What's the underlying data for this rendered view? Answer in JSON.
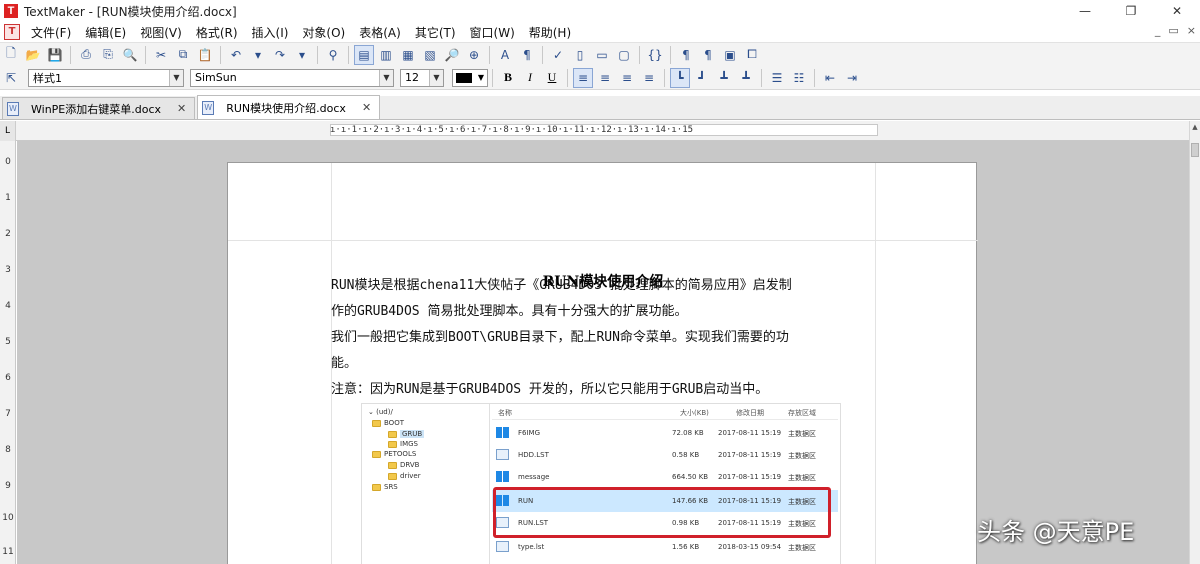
{
  "window": {
    "title": "TextMaker - [RUN模块使用介绍.docx]",
    "minimize_icon": "minimize-icon",
    "maximize_icon": "maximize-icon",
    "close_icon": "close-icon"
  },
  "menu": {
    "items": [
      "文件(F)",
      "编辑(E)",
      "视图(V)",
      "格式(R)",
      "插入(I)",
      "对象(O)",
      "表格(A)",
      "其它(T)",
      "窗口(W)",
      "帮助(H)"
    ],
    "right_controls": [
      "_",
      "▭",
      "×"
    ]
  },
  "format_toolbar": {
    "style": "样式1",
    "font": "SimSun",
    "size": "12",
    "font_color": "#000000",
    "bold": "B",
    "italic": "I",
    "underline": "U"
  },
  "tabs": [
    {
      "label": "WinPE添加右键菜单.docx",
      "active": false
    },
    {
      "label": "RUN模块使用介绍.docx",
      "active": true
    }
  ],
  "ruler": {
    "horizontal": "ı·ı·1·ı·2·ı·3·ı·4·ı·5·ı·6·ı·7·ı·8·ı·9·ı·10·ı·11·ı·12·ı·13·ı·14·ı·15",
    "vertical": [
      "0",
      "1",
      "2",
      "3",
      "4",
      "5",
      "6",
      "7",
      "8",
      "9",
      "10",
      "11"
    ]
  },
  "document": {
    "title": "RUN模块使用介绍",
    "lines": [
      "    RUN模块是根据chena11大侠帖子《GRUB4DOS 批处理脚本的简易应用》启发制",
      "作的GRUB4DOS 简易批处理脚本。具有十分强大的扩展功能。",
      "    我们一般把它集成到BOOT\\GRUB目录下，配上RUN命令菜单。实现我们需要的功",
      "能。",
      "    注意：因为RUN是基于GRUB4DOS 开发的，所以它只能用于GRUB启动当中。"
    ]
  },
  "embedded_screenshot": {
    "tree": [
      {
        "label": "(ud)/",
        "indent": 0
      },
      {
        "label": "BOOT",
        "indent": 1
      },
      {
        "label": "GRUB",
        "indent": 2,
        "selected": true
      },
      {
        "label": "IMGS",
        "indent": 2
      },
      {
        "label": "PETOOLS",
        "indent": 1
      },
      {
        "label": "DRVB",
        "indent": 2
      },
      {
        "label": "driver",
        "indent": 2
      },
      {
        "label": "SRS",
        "indent": 1
      }
    ],
    "headers": [
      "名称",
      "大小(KB)",
      "修改日期",
      "存放区域"
    ],
    "rows": [
      {
        "name": "F6IMG",
        "size": "72.08 KB",
        "date": "2017-08-11 15:19",
        "area": "主数据区",
        "icon": "win"
      },
      {
        "name": "HDD.LST",
        "size": "0.58 KB",
        "date": "2017-08-11 15:19",
        "area": "主数据区",
        "icon": "doc"
      },
      {
        "name": "message",
        "size": "664.50 KB",
        "date": "2017-08-11 15:19",
        "area": "主数据区",
        "icon": "win"
      },
      {
        "name": "RUN",
        "size": "147.66 KB",
        "date": "2017-08-11 15:19",
        "area": "主数据区",
        "icon": "win",
        "selected": true
      },
      {
        "name": "RUN.LST",
        "size": "0.98 KB",
        "date": "2017-08-11 15:19",
        "area": "主数据区",
        "icon": "doc"
      },
      {
        "name": "type.lst",
        "size": "1.56 KB",
        "date": "2018-03-15 09:54",
        "area": "主数据区",
        "icon": "doc"
      }
    ],
    "highlight_color": "#d0202a"
  },
  "watermark": "头条 @天意PE"
}
